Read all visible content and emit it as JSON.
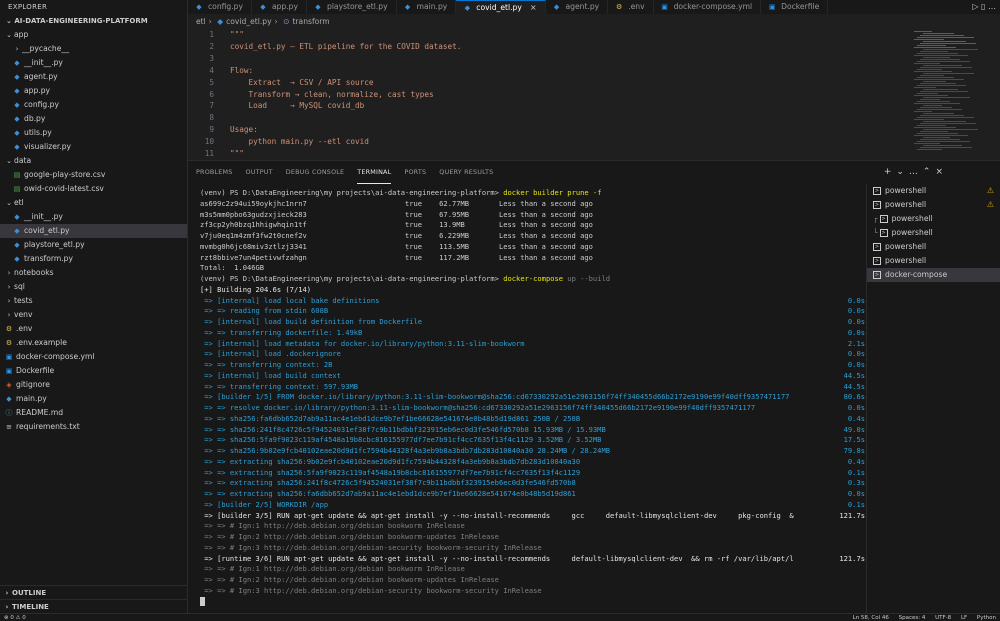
{
  "explorer": {
    "title": "EXPLORER",
    "project": "AI-DATA-ENGINEERING-PLATFORM",
    "tree": [
      {
        "label": "app",
        "type": "folder",
        "depth": 0,
        "open": true
      },
      {
        "label": "__pycache__",
        "type": "folder",
        "depth": 1,
        "open": false
      },
      {
        "label": "__init__.py",
        "type": "py",
        "depth": 1
      },
      {
        "label": "agent.py",
        "type": "py",
        "depth": 1
      },
      {
        "label": "app.py",
        "type": "py",
        "depth": 1
      },
      {
        "label": "config.py",
        "type": "py",
        "depth": 1
      },
      {
        "label": "db.py",
        "type": "py",
        "depth": 1
      },
      {
        "label": "utils.py",
        "type": "py",
        "depth": 1
      },
      {
        "label": "visualizer.py",
        "type": "py",
        "depth": 1
      },
      {
        "label": "data",
        "type": "folder",
        "depth": 0,
        "open": true
      },
      {
        "label": "google-play-store.csv",
        "type": "csv",
        "depth": 1
      },
      {
        "label": "owid-covid-latest.csv",
        "type": "csv",
        "depth": 1
      },
      {
        "label": "etl",
        "type": "folder",
        "depth": 0,
        "open": true
      },
      {
        "label": "__init__.py",
        "type": "py",
        "depth": 1
      },
      {
        "label": "covid_etl.py",
        "type": "py",
        "depth": 1,
        "selected": true
      },
      {
        "label": "playstore_etl.py",
        "type": "py",
        "depth": 1
      },
      {
        "label": "transform.py",
        "type": "py",
        "depth": 1
      },
      {
        "label": "notebooks",
        "type": "folder",
        "depth": 0,
        "open": false
      },
      {
        "label": "sql",
        "type": "folder",
        "depth": 0,
        "open": false
      },
      {
        "label": "tests",
        "type": "folder",
        "depth": 0,
        "open": false
      },
      {
        "label": "venv",
        "type": "folder",
        "depth": 0,
        "open": false
      },
      {
        "label": ".env",
        "type": "env",
        "depth": 0
      },
      {
        "label": ".env.example",
        "type": "env",
        "depth": 0
      },
      {
        "label": "docker-compose.yml",
        "type": "docker",
        "depth": 0
      },
      {
        "label": "Dockerfile",
        "type": "docker",
        "depth": 0
      },
      {
        "label": "gitignore",
        "type": "git",
        "depth": 0
      },
      {
        "label": "main.py",
        "type": "py",
        "depth": 0
      },
      {
        "label": "README.md",
        "type": "md",
        "depth": 0
      },
      {
        "label": "requirements.txt",
        "type": "txt",
        "depth": 0
      }
    ],
    "outline": "OUTLINE",
    "timeline": "TIMELINE"
  },
  "tabs": [
    {
      "label": "config.py",
      "type": "py"
    },
    {
      "label": "app.py",
      "type": "py"
    },
    {
      "label": "playstore_etl.py",
      "type": "py"
    },
    {
      "label": "main.py",
      "type": "py"
    },
    {
      "label": "covid_etl.py",
      "type": "py",
      "active": true
    },
    {
      "label": "agent.py",
      "type": "py"
    },
    {
      "label": ".env",
      "type": "env"
    },
    {
      "label": "docker-compose.yml",
      "type": "docker"
    },
    {
      "label": "Dockerfile",
      "type": "docker"
    }
  ],
  "breadcrumb": {
    "folder": "etl",
    "file": "covid_etl.py",
    "symbol": "transform"
  },
  "code": [
    {
      "n": "1",
      "text": "\"\"\""
    },
    {
      "n": "2",
      "text": "covid_etl.py — ETL pipeline for the COVID dataset."
    },
    {
      "n": "3",
      "text": ""
    },
    {
      "n": "4",
      "text": "Flow:"
    },
    {
      "n": "5",
      "text": "    Extract  → CSV / API source"
    },
    {
      "n": "6",
      "text": "    Transform → clean, normalize, cast types"
    },
    {
      "n": "7",
      "text": "    Load     → MySQL covid_db"
    },
    {
      "n": "8",
      "text": ""
    },
    {
      "n": "9",
      "text": "Usage:"
    },
    {
      "n": "10",
      "text": "    python main.py --etl covid"
    },
    {
      "n": "11",
      "text": "\"\"\""
    }
  ],
  "panel_tabs": [
    {
      "label": "PROBLEMS"
    },
    {
      "label": "OUTPUT"
    },
    {
      "label": "DEBUG CONSOLE"
    },
    {
      "label": "TERMINAL",
      "active": true
    },
    {
      "label": "PORTS"
    },
    {
      "label": "QUERY RESULTS"
    }
  ],
  "terminal_lines": [
    {
      "text": "(venv) PS D:\\DataEngineering\\my projects\\ai-data-engineering-platform> ",
      "cmd": "docker builder prune -f",
      "color": "white"
    },
    {
      "text": "as699c2z94ui59oykjhc1nrn7                       true    62.77MB       Less than a second ago",
      "color": "white"
    },
    {
      "text": "m3s5mm0pbo63gudzxjieck283                       true    67.95MB       Less than a second ago",
      "color": "white"
    },
    {
      "text": "zf3cp2yh0bzq1hhigwhqin1tf                       true    13.9MB        Less than a second ago",
      "color": "white"
    },
    {
      "text": "v7ju0eq1m4zmf3fw2t0cnef2v                       true    6.229MB       Less than a second ago",
      "color": "white"
    },
    {
      "text": "mvmbg0h6jc68miv3ztlzj3341                       true    113.5MB       Less than a second ago",
      "color": "white"
    },
    {
      "text": "rzt8bbive7un4petivwfzahgn                       true    117.2MB       Less than a second ago",
      "color": "white"
    },
    {
      "text": "Total:  1.046GB",
      "color": "white"
    },
    {
      "text": "(venv) PS D:\\DataEngineering\\my projects\\ai-data-engineering-platform> ",
      "cmd": "docker-compose",
      "cmdrest": " up --build",
      "color": "white"
    },
    {
      "text": "[+] Building 204.6s (7/14)",
      "color": "bright"
    },
    {
      "text": " => [internal] load local bake definitions",
      "time": "0.0s",
      "color": "blue"
    },
    {
      "text": " => => reading from stdin 608B",
      "time": "0.0s",
      "color": "blue"
    },
    {
      "text": " => [internal] load build definition from Dockerfile",
      "time": "0.0s",
      "color": "blue"
    },
    {
      "text": " => => transferring dockerfile: 1.49kB",
      "time": "0.0s",
      "color": "blue"
    },
    {
      "text": " => [internal] load metadata for docker.io/library/python:3.11-slim-bookworm",
      "time": "2.1s",
      "color": "blue"
    },
    {
      "text": " => [internal] load .dockerignore",
      "time": "0.0s",
      "color": "blue"
    },
    {
      "text": " => => transferring context: 2B",
      "time": "0.0s",
      "color": "blue"
    },
    {
      "text": " => [internal] load build context",
      "time": "44.5s",
      "color": "blue"
    },
    {
      "text": " => => transferring context: 597.93MB",
      "time": "44.5s",
      "color": "blue"
    },
    {
      "text": " => [builder 1/5] FROM docker.io/library/python:3.11-slim-bookworm@sha256:cd67330292a51e2963156f74ff340455d66b2172e9190e99f40dff9357471177",
      "time": "80.6s",
      "color": "blue"
    },
    {
      "text": " => => resolve docker.io/library/python:3.11-slim-bookworm@sha256:cd67330292a51e2963156f74ff340455d66b2172e9190e99f40dff9357471177",
      "time": "0.0s",
      "color": "blue"
    },
    {
      "text": " => => sha256:fa6dbb652d7ab9a11ac4e1ebd1dce9b7ef1be66628e541674e0b48b5d19d861 250B / 250B",
      "time": "0.4s",
      "color": "blue"
    },
    {
      "text": " => => sha256:241f8c4726c5f94524031ef38f7c9b11bdbbf323915eb6ec0d3fe546fd570b8 15.93MB / 15.93MB",
      "time": "49.0s",
      "color": "blue"
    },
    {
      "text": " => => sha256:5fa9f9023c119af4548a19b8cbc816155977df7ee7b91cf4cc7635f13f4c1129 3.52MB / 3.52MB",
      "time": "17.5s",
      "color": "blue"
    },
    {
      "text": " => => sha256:9b02e9fcb40102eae20d9d1fc7594b44328f4a3eb9b8a3bdb7db283d10840a30 28.24MB / 28.24MB",
      "time": "79.8s",
      "color": "blue"
    },
    {
      "text": " => => extracting sha256:9b02e9fcb40102eae20d9d1fc7594b44328f4a3eb9b8a3bdb7db283d10840a30",
      "time": "0.4s",
      "color": "blue"
    },
    {
      "text": " => => extracting sha256:5fa9f9023c119af4548a19b8cbc816155977df7ee7b91cf4cc7635f13f4c1129",
      "time": "0.1s",
      "color": "blue"
    },
    {
      "text": " => => extracting sha256:241f8c4726c5f94524031ef38f7c9b11bdbbf323915eb6ec0d3fe546fd570b8",
      "time": "0.3s",
      "color": "blue"
    },
    {
      "text": " => => extracting sha256:fa6dbb652d7ab9a11ac4e1ebd1dce9b7ef1be66628e541674e0b48b5d19d861",
      "time": "0.0s",
      "color": "blue"
    },
    {
      "text": " => [builder 2/5] WORKDIR /app",
      "time": "0.1s",
      "color": "blue"
    },
    {
      "text": " => [builder 3/5] RUN apt-get update && apt-get install -y --no-install-recommends     gcc     default-libmysqlclient-dev     pkg-config  &",
      "time": "121.7s",
      "color": "bright"
    },
    {
      "text": " => => # Ign:1 http://deb.debian.org/debian bookworm InRelease",
      "color": "dim"
    },
    {
      "text": " => => # Ign:2 http://deb.debian.org/debian bookworm-updates InRelease",
      "color": "dim"
    },
    {
      "text": " => => # Ign:3 http://deb.debian.org/debian-security bookworm-security InRelease",
      "color": "dim"
    },
    {
      "text": " => [runtime 3/6] RUN apt-get update && apt-get install -y --no-install-recommends     default-libmysqlclient-dev  && rm -rf /var/lib/apt/l",
      "time": "121.7s",
      "color": "bright"
    },
    {
      "text": " => => # Ign:1 http://deb.debian.org/debian bookworm InRelease",
      "color": "dim"
    },
    {
      "text": " => => # Ign:2 http://deb.debian.org/debian bookworm-updates InRelease",
      "color": "dim"
    },
    {
      "text": " => => # Ign:3 http://deb.debian.org/debian-security bookworm-security InRelease",
      "color": "dim"
    }
  ],
  "terminals": [
    {
      "label": "powershell",
      "warn": true
    },
    {
      "label": "powershell",
      "warn": true
    },
    {
      "label": "powershell",
      "prefix": "┌"
    },
    {
      "label": "powershell",
      "prefix": "└"
    },
    {
      "label": "powershell"
    },
    {
      "label": "powershell"
    },
    {
      "label": "docker-compose",
      "active": true
    }
  ],
  "status": {
    "position": "Ln 58, Col 46",
    "spaces": "Spaces: 4",
    "encoding": "UTF-8",
    "eol": "LF",
    "language": "Python"
  }
}
